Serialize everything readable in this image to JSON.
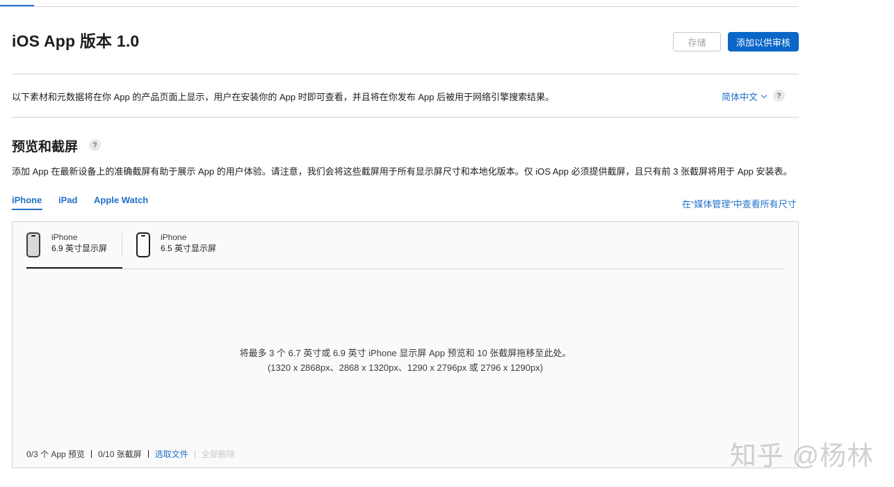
{
  "page": {
    "title": "iOS App 版本 1.0",
    "buttons": {
      "save": "存储",
      "submit": "添加以供审核"
    },
    "intro": "以下素材和元数据将在你 App 的产品页面上显示，用户在安装你的 App 时即可查看，并且将在你发布 App 后被用于网络引擎搜索结果。",
    "language": "简体中文"
  },
  "preview_section": {
    "title": "预览和截屏",
    "description": "添加 App 在最新设备上的准确截屏有助于展示 App 的用户体验。请注意，我们会将这些截屏用于所有显示屏尺寸和本地化版本。仅 iOS App 必须提供截屏，且只有前 3 张截屏将用于 App 安装表。",
    "device_tabs": [
      "iPhone",
      "iPad",
      "Apple Watch"
    ],
    "media_link": "在“媒体管理”中查看所有尺寸",
    "size_tabs": [
      {
        "device": "iPhone",
        "label": "6.9 英寸显示屏"
      },
      {
        "device": "iPhone",
        "label": "6.5 英寸显示屏"
      }
    ],
    "drop_text": "将最多 3 个 6.7 英寸或 6.9 英寸 iPhone 显示屏 App 预览和 10 张截屏拖移至此处。",
    "drop_sizes": "(1320 x 2868px、2868 x 1320px、1290 x 2796px 或 2796 x 1290px)",
    "footer": {
      "previews": "0/3 个 App 预览",
      "screenshots": "0/10 张截屏",
      "choose_file": "选取文件",
      "delete_all": "全部删除"
    }
  },
  "watermark": "知乎 @杨林",
  "colors": {
    "accent": "#2271c7",
    "primary_button": "#0a66c8",
    "border": "#d2d2d7"
  }
}
